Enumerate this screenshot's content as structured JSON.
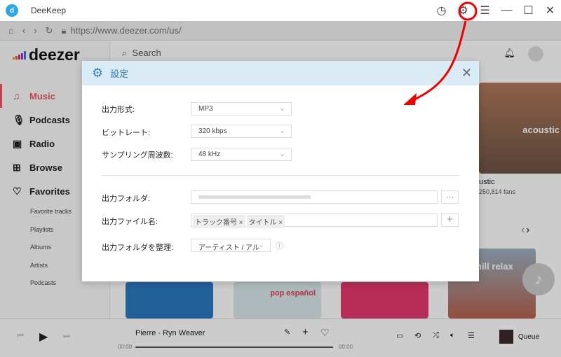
{
  "app": {
    "title": "DeeKeep"
  },
  "browser": {
    "url": "https://www.deezer.com/us/"
  },
  "sidebar": {
    "logo": "deezer",
    "items": [
      {
        "label": "Music",
        "icon": "music-note-icon"
      },
      {
        "label": "Podcasts",
        "icon": "microphone-icon"
      },
      {
        "label": "Radio",
        "icon": "radio-icon"
      },
      {
        "label": "Browse",
        "icon": "grid-icon"
      },
      {
        "label": "Favorites",
        "icon": "heart-icon"
      }
    ],
    "sub_items": [
      "Favorite tracks",
      "Playlists",
      "Albums",
      "Artists",
      "Podcasts"
    ]
  },
  "main": {
    "search_placeholder": "Search",
    "card_title": "acoustic",
    "card_name": "ustic",
    "card_fans": "250,814 fans",
    "card2_title": "hill relax",
    "card_pop": "pop español"
  },
  "dialog": {
    "title": "設定",
    "rows": {
      "format_label": "出力形式:",
      "format_value": "MP3",
      "bitrate_label": "ビットレート:",
      "bitrate_value": "320 kbps",
      "sample_label": "サンプリング周波数:",
      "sample_value": "48 kHz",
      "folder_label": "出力フォルダ:",
      "folder_btn": "···",
      "filename_label": "出力ファイル名:",
      "tags": [
        "トラック番号 ×",
        "タイトル ×"
      ],
      "add_btn": "+",
      "organize_label": "出力フォルダを整理:",
      "organize_value": "アーティスト / アル"
    }
  },
  "player": {
    "track": "Pierre · Ryn Weaver",
    "time_start": "00:00",
    "time_end": "00:00",
    "queue": "Queue",
    "progress": 0
  }
}
